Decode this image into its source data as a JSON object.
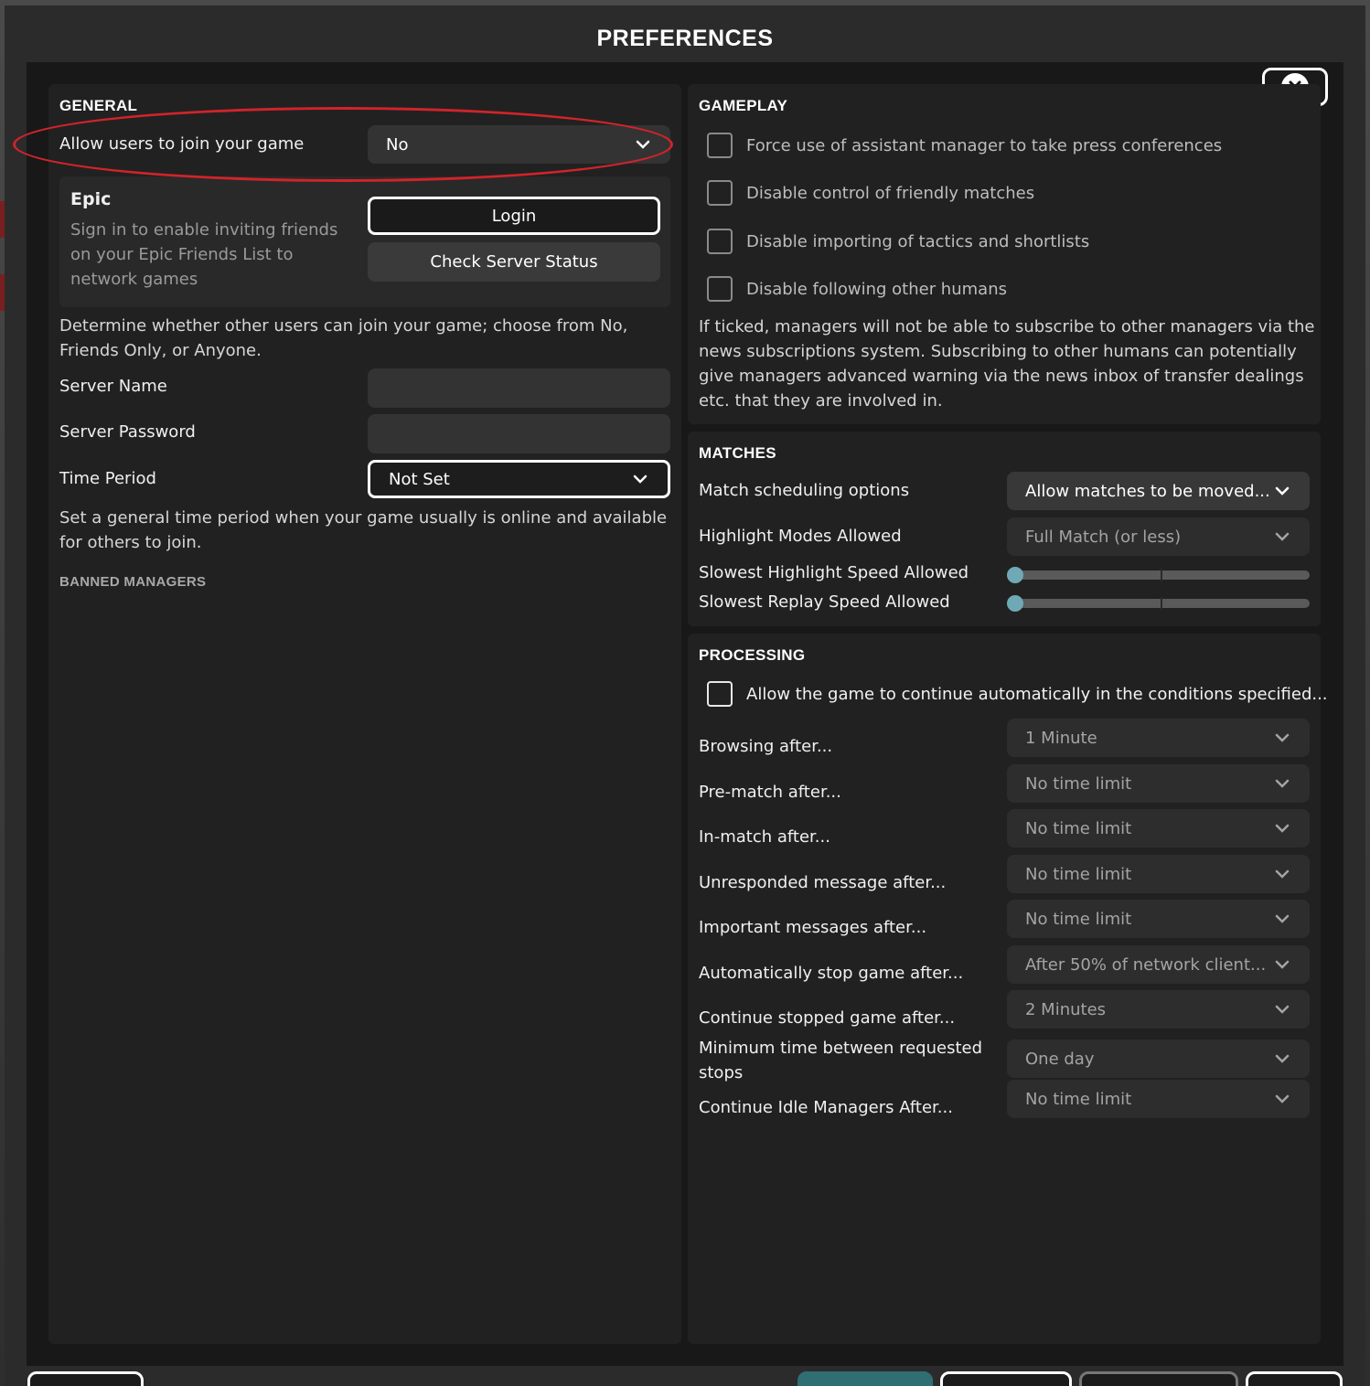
{
  "dialog": {
    "title": "PREFERENCES"
  },
  "general": {
    "heading": "GENERAL",
    "allow_join": {
      "label": "Allow users to join your game",
      "value": "No"
    },
    "epic": {
      "title": "Epic",
      "description": "Sign in to enable inviting friends on your Epic Friends List to network games",
      "login_label": "Login",
      "server_status_label": "Check Server Status"
    },
    "join_description": "Determine whether other users can join your game; choose from No, Friends Only, or Anyone.",
    "server_name": {
      "label": "Server Name",
      "value": ""
    },
    "server_password": {
      "label": "Server Password",
      "value": ""
    },
    "time_period": {
      "label": "Time Period",
      "value": "Not Set"
    },
    "time_period_description": "Set a general time period when your game usually is online and available for others to join.",
    "banned_heading": "BANNED MANAGERS"
  },
  "gameplay": {
    "heading": "GAMEPLAY",
    "options": [
      {
        "label": "Force use of assistant manager to take press conferences",
        "checked": false
      },
      {
        "label": "Disable control of friendly matches",
        "checked": false
      },
      {
        "label": "Disable importing of tactics and shortlists",
        "checked": false
      },
      {
        "label": "Disable following other humans",
        "checked": false
      }
    ],
    "description": "If ticked, managers will not be able to subscribe to other managers via the news subscriptions system. Subscribing to other humans can potentially give managers advanced warning via the news inbox of transfer dealings etc. that they are involved in."
  },
  "matches": {
    "heading": "MATCHES",
    "scheduling": {
      "label": "Match scheduling options",
      "value": "Allow matches to be moved..."
    },
    "highlight_modes": {
      "label": "Highlight Modes Allowed",
      "value": "Full Match (or less)"
    },
    "slowest_highlight": {
      "label": "Slowest Highlight Speed Allowed",
      "level": 0
    },
    "slowest_replay": {
      "label": "Slowest Replay Speed Allowed",
      "level": 0
    }
  },
  "processing": {
    "heading": "PROCESSING",
    "auto_continue": {
      "label": "Allow the game to continue automatically in the conditions specified...",
      "checked": false
    },
    "rows": [
      {
        "label": "Browsing after...",
        "value": "1 Minute"
      },
      {
        "label": "Pre-match after...",
        "value": "No time limit"
      },
      {
        "label": "In-match after...",
        "value": "No time limit"
      },
      {
        "label": "Unresponded message after...",
        "value": "No time limit"
      },
      {
        "label": "Important messages after...",
        "value": "No time limit"
      },
      {
        "label": "Automatically stop game after...",
        "value": "After 50% of network client..."
      },
      {
        "label": "Continue stopped game after...",
        "value": "2 Minutes"
      },
      {
        "label": "Minimum time between requested stops",
        "value": "One day"
      },
      {
        "label": "Continue Idle Managers After...",
        "value": "No time limit"
      }
    ]
  },
  "icons": {
    "close": "close-icon",
    "chevron": "chevron-down-icon"
  },
  "colors": {
    "annotation": "#d2232a",
    "accent": "#6fa9b6",
    "confirm": "#2f6f73"
  }
}
